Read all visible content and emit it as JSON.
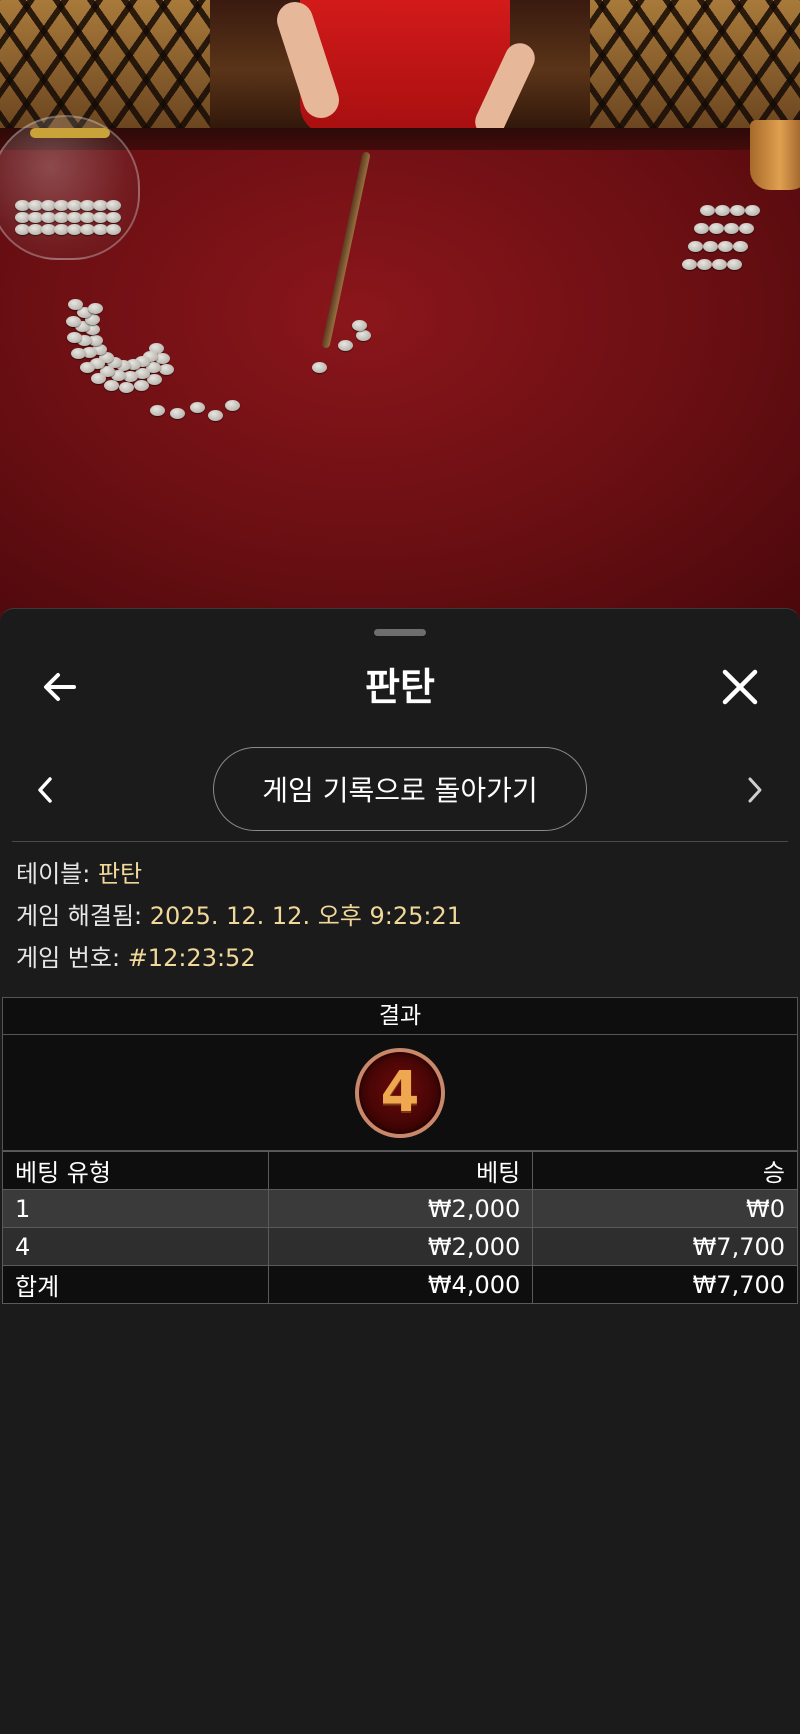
{
  "sheet": {
    "title": "판탄",
    "history_button": "게임 기록으로 돌아가기"
  },
  "info": {
    "table_label": "테이블:",
    "table_value": "판탄",
    "resolved_label": "게임 해결됨:",
    "resolved_value": "2025. 12. 12. 오후 9:25:21",
    "game_no_label": "게임 번호:",
    "game_no_value": "#12:23:52"
  },
  "result": {
    "header": "결과",
    "number": "4"
  },
  "bets": {
    "headers": [
      "베팅 유형",
      "베팅",
      "승"
    ],
    "rows": [
      {
        "type": "1",
        "bet": "₩2,000",
        "win": "₩0"
      },
      {
        "type": "4",
        "bet": "₩2,000",
        "win": "₩7,700"
      }
    ],
    "total": {
      "type": "합계",
      "bet": "₩4,000",
      "win": "₩7,700"
    }
  },
  "icons": {
    "back": "arrow-left-icon",
    "close": "close-icon",
    "prev": "chevron-left-icon",
    "next": "chevron-right-icon"
  },
  "colors": {
    "sheet_bg": "#1b1b1b",
    "info_value": "#f1d89a",
    "result_ball_border": "#c9886a",
    "result_number": "#f0a850",
    "table_felt": "#7e1418"
  }
}
